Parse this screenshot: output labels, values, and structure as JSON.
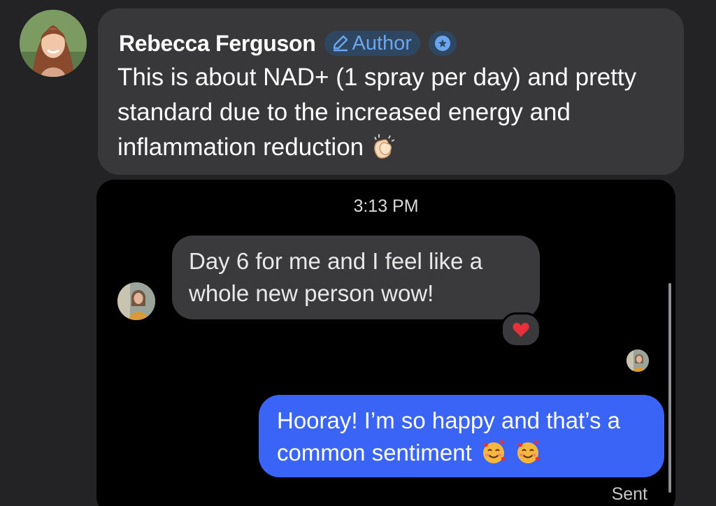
{
  "comment": {
    "author_name": "Rebecca Ferguson",
    "author_badge": "Author",
    "text": "This is about NAD+ (1 spray per day) and pretty standard due to the increased energy and inflammation reduction",
    "avatar_icon": "profile-photo",
    "badge_icon": "pencil-icon",
    "verified_icon": "verified-badge-icon",
    "trailing_emoji": "clapping-hands-icon"
  },
  "screenshot": {
    "timestamp": "3:13 PM",
    "incoming_message": "Day 6 for me and I feel like a whole new person wow!",
    "incoming_reaction": "heart-icon",
    "outgoing_message": "Hooray! I’m so happy and that’s a common sentiment",
    "outgoing_emojis": [
      "smiling-face-with-hearts-icon",
      "smiling-face-with-hearts-icon"
    ],
    "status": "Sent"
  },
  "colors": {
    "background": "#232325",
    "comment_bubble": "#38383b",
    "badge_text": "#6aa6f0",
    "incoming_bubble": "#3a3a3c",
    "outgoing_bubble": "#3a64f6",
    "heart": "#e8303a"
  }
}
